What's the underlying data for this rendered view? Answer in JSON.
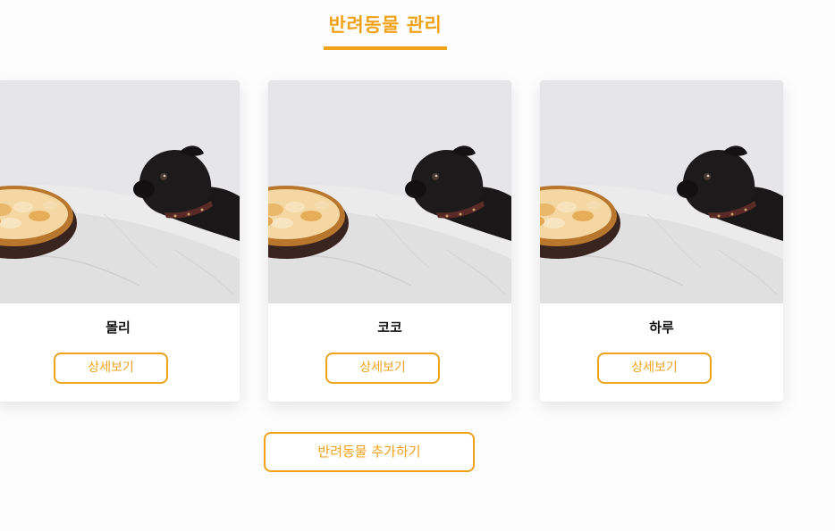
{
  "header": {
    "title": "반려동물 관리"
  },
  "pets": [
    {
      "name": "몰리",
      "detail_label": "상세보기"
    },
    {
      "name": "코코",
      "detail_label": "상세보기"
    },
    {
      "name": "하루",
      "detail_label": "상세보기"
    }
  ],
  "actions": {
    "add_pet_label": "반려동물 추가하기"
  },
  "colors": {
    "accent": "#f0a21a",
    "card_background": "#ffffff",
    "page_background": "#fdfdfd"
  }
}
